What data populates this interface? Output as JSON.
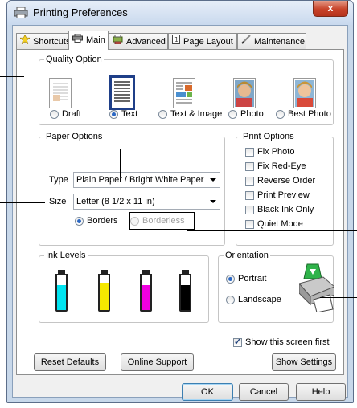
{
  "window": {
    "title": "Printing Preferences",
    "close_label": "x"
  },
  "tabs": [
    {
      "label": "Shortcuts",
      "active": false
    },
    {
      "label": "Main",
      "active": true
    },
    {
      "label": "Advanced",
      "active": false
    },
    {
      "label": "Page Layout",
      "active": false
    },
    {
      "label": "Maintenance",
      "active": false
    }
  ],
  "quality": {
    "group_label": "Quality Option",
    "options": [
      {
        "label": "Draft",
        "checked": false
      },
      {
        "label": "Text",
        "checked": true
      },
      {
        "label": "Text & Image",
        "checked": false
      },
      {
        "label": "Photo",
        "checked": false
      },
      {
        "label": "Best Photo",
        "checked": false
      }
    ]
  },
  "paper": {
    "group_label": "Paper Options",
    "type_label": "Type",
    "type_value": "Plain Paper / Bright White Paper",
    "size_label": "Size",
    "size_value": "Letter (8 1/2 x 11 in)",
    "borders_label": "Borders",
    "borderless_label": "Borderless"
  },
  "print_options": {
    "group_label": "Print Options",
    "items": [
      {
        "label": "Fix Photo",
        "checked": false
      },
      {
        "label": "Fix Red-Eye",
        "checked": false
      },
      {
        "label": "Reverse Order",
        "checked": false
      },
      {
        "label": "Print Preview",
        "checked": false
      },
      {
        "label": "Black Ink Only",
        "checked": false
      },
      {
        "label": "Quiet Mode",
        "checked": false
      }
    ]
  },
  "ink": {
    "group_label": "Ink Levels",
    "cartridges": [
      {
        "color": "#00e4f0",
        "level": 0.72
      },
      {
        "color": "#f5e800",
        "level": 0.78
      },
      {
        "color": "#f000e0",
        "level": 0.72
      },
      {
        "color": "#000000",
        "level": 0.72
      }
    ]
  },
  "orientation": {
    "group_label": "Orientation",
    "portrait_label": "Portrait",
    "landscape_label": "Landscape"
  },
  "show_first_label": "Show this screen first",
  "buttons": {
    "reset": "Reset Defaults",
    "support": "Online Support",
    "show_settings": "Show Settings",
    "ok": "OK",
    "cancel": "Cancel",
    "help": "Help"
  },
  "colors": {
    "accent": "#2a67c4",
    "title_bg": "#c9d9ee",
    "close_red": "#c8432a"
  }
}
